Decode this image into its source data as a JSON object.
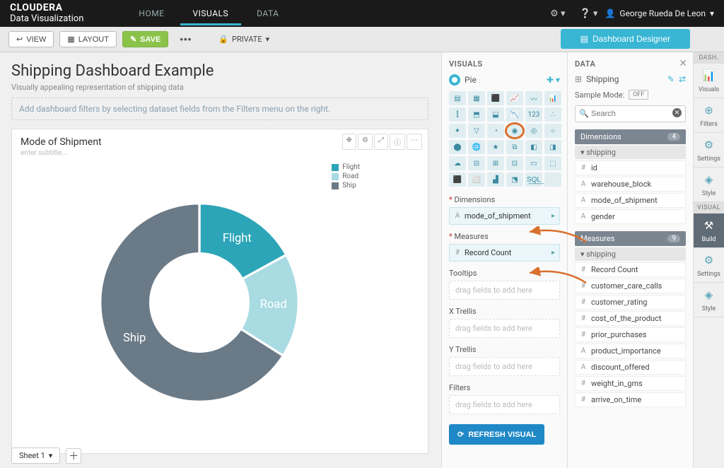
{
  "brand": {
    "name": "CLOUDERA",
    "sub": "Data Visualization"
  },
  "nav": {
    "home": "HOME",
    "visuals": "VISUALS",
    "data": "DATA",
    "user": "George Rueda De Leon"
  },
  "toolbar": {
    "view": "VIEW",
    "layout": "LAYOUT",
    "save": "SAVE",
    "private": "PRIVATE",
    "dash_designer": "Dashboard Designer"
  },
  "dashboard": {
    "title": "Shipping Dashboard Example",
    "subtitle": "Visually appealing representation of shipping data",
    "filter_hint": "Add dashboard filters by selecting dataset fields from the Filters menu on the right."
  },
  "visual_card": {
    "title": "Mode of Shipment",
    "subtitle_placeholder": "enter subtitle...",
    "legend": [
      "Flight",
      "Road",
      "Ship"
    ]
  },
  "chart_data": {
    "type": "pie",
    "donut": true,
    "categories": [
      "Flight",
      "Road",
      "Ship"
    ],
    "values": [
      17,
      17,
      66
    ],
    "colors": [
      "#2ca5b8",
      "#a9dbe3",
      "#6b7a87"
    ],
    "labels_on_slices": [
      "Flight",
      "Road",
      "Ship"
    ]
  },
  "visuals_panel": {
    "header": "VISUALS",
    "current_type": "Pie",
    "grid_count": 36,
    "selected_index": 15,
    "shelves": {
      "dimensions": {
        "label": "Dimensions",
        "required": true,
        "chip": "mode_of_shipment",
        "chip_type": "A"
      },
      "measures": {
        "label": "Measures",
        "required": true,
        "chip": "Record Count",
        "chip_type": "#"
      },
      "tooltips": {
        "label": "Tooltips",
        "placeholder": "drag fields to add here"
      },
      "xtrellis": {
        "label": "X Trellis",
        "placeholder": "drag fields to add here"
      },
      "ytrellis": {
        "label": "Y Trellis",
        "placeholder": "drag fields to add here"
      },
      "filters": {
        "label": "Filters",
        "placeholder": "drag fields to add here"
      }
    },
    "refresh": "REFRESH VISUAL"
  },
  "data_panel": {
    "header": "DATA",
    "dataset": "Shipping",
    "sample_mode_label": "Sample Mode:",
    "sample_mode_value": "OFF",
    "search_placeholder": "Search",
    "dimensions": {
      "header": "Dimensions",
      "count": "4",
      "group": "shipping",
      "fields": [
        {
          "t": "#",
          "n": "id"
        },
        {
          "t": "A",
          "n": "warehouse_block"
        },
        {
          "t": "A",
          "n": "mode_of_shipment"
        },
        {
          "t": "A",
          "n": "gender"
        }
      ]
    },
    "measures": {
      "header": "Measures",
      "count": "9",
      "group": "shipping",
      "fields": [
        {
          "t": "#",
          "n": "Record Count"
        },
        {
          "t": "#",
          "n": "customer_care_calls"
        },
        {
          "t": "#",
          "n": "customer_rating"
        },
        {
          "t": "#",
          "n": "cost_of_the_product"
        },
        {
          "t": "#",
          "n": "prior_purchases"
        },
        {
          "t": "A",
          "n": "product_importance"
        },
        {
          "t": "A",
          "n": "discount_offered"
        },
        {
          "t": "#",
          "n": "weight_in_gms"
        },
        {
          "t": "#",
          "n": "arrive_on_time"
        }
      ]
    }
  },
  "rail": {
    "dash_header": "DASH.",
    "visual_header": "VISUAL",
    "items_dash": [
      {
        "icon": "📊",
        "label": "Visuals"
      },
      {
        "icon": "⊕",
        "label": "Filters"
      },
      {
        "icon": "⚙",
        "label": "Settings"
      },
      {
        "icon": "◈",
        "label": "Style"
      }
    ],
    "items_visual": [
      {
        "icon": "⚒",
        "label": "Build",
        "active": true
      },
      {
        "icon": "⚙",
        "label": "Settings"
      },
      {
        "icon": "◈",
        "label": "Style"
      }
    ]
  },
  "sheets": {
    "tab1": "Sheet 1"
  }
}
